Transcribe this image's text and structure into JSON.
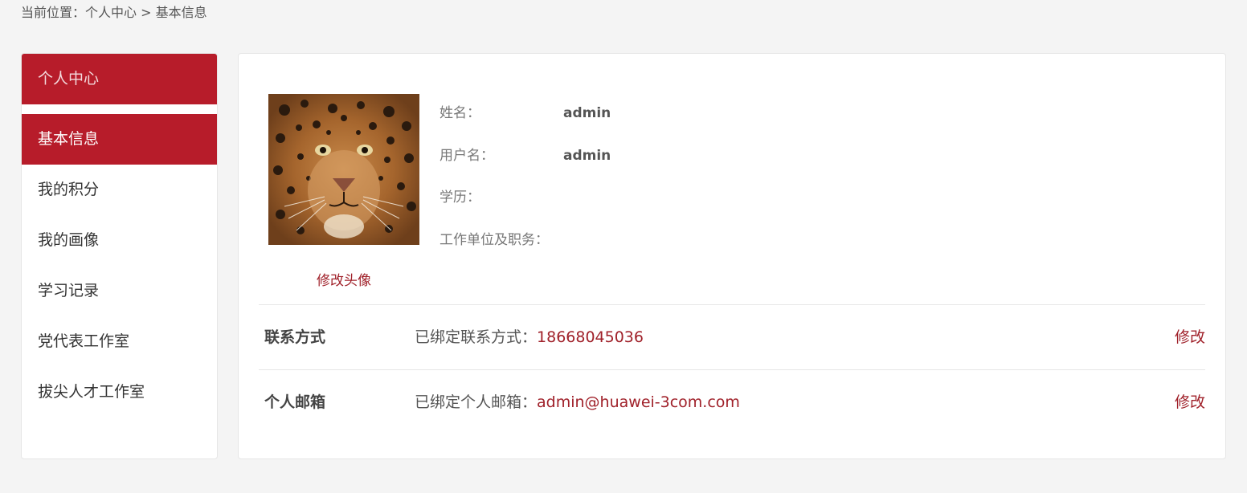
{
  "breadcrumb": {
    "label": "当前位置：",
    "path": "个人中心 > 基本信息"
  },
  "sidebar": {
    "title": "个人中心",
    "items": [
      {
        "label": "基本信息",
        "active": true
      },
      {
        "label": "我的积分",
        "active": false
      },
      {
        "label": "我的画像",
        "active": false
      },
      {
        "label": "学习记录",
        "active": false
      },
      {
        "label": "党代表工作室",
        "active": false
      },
      {
        "label": "拔尖人才工作室",
        "active": false
      }
    ]
  },
  "profile": {
    "avatar_icon": "leopard-photo",
    "change_avatar": "修改头像",
    "fields": [
      {
        "label": "姓名：",
        "value": "admin"
      },
      {
        "label": "用户名：",
        "value": "admin"
      },
      {
        "label": "学历：",
        "value": ""
      },
      {
        "label": "工作单位及职务：",
        "value": ""
      }
    ]
  },
  "contacts": [
    {
      "title": "联系方式",
      "desc": "已绑定联系方式：",
      "value": "18668045036",
      "edit": "修改"
    },
    {
      "title": "个人邮箱",
      "desc": "已绑定个人邮箱：",
      "value": "admin@huawei-3com.com",
      "edit": "修改"
    }
  ],
  "colors": {
    "accent": "#b71c2a",
    "link": "#a0212a",
    "background": "#f4f4f4"
  }
}
